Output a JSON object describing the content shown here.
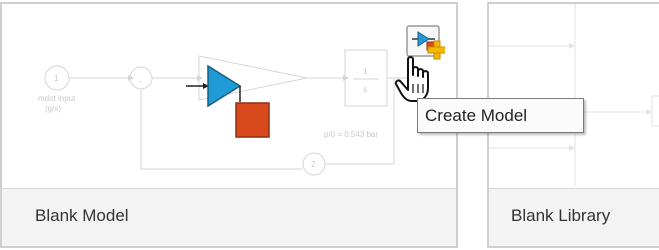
{
  "cards": [
    {
      "label": "Blank Model"
    },
    {
      "label": "Blank Library"
    }
  ],
  "thumbnail": {
    "inport_number": "1",
    "inport_label_line1": "mdot input",
    "inport_label_line2": "(g/s)",
    "sum_minus": "-",
    "integrator_num": "1",
    "integrator_den": "s",
    "pressure_text": "p/0 = 0.543 bar",
    "outport_number": "2"
  },
  "create_button": {
    "icon": "create-model-icon"
  },
  "tooltip": {
    "text": "Create Model"
  },
  "colors": {
    "gain_fill": "#1e9bd7",
    "new_block_fill": "#d84a1b",
    "plus_badge": "#f5b800",
    "card_border": "#cfcfcf",
    "footer_bg": "#f3f3f3"
  }
}
